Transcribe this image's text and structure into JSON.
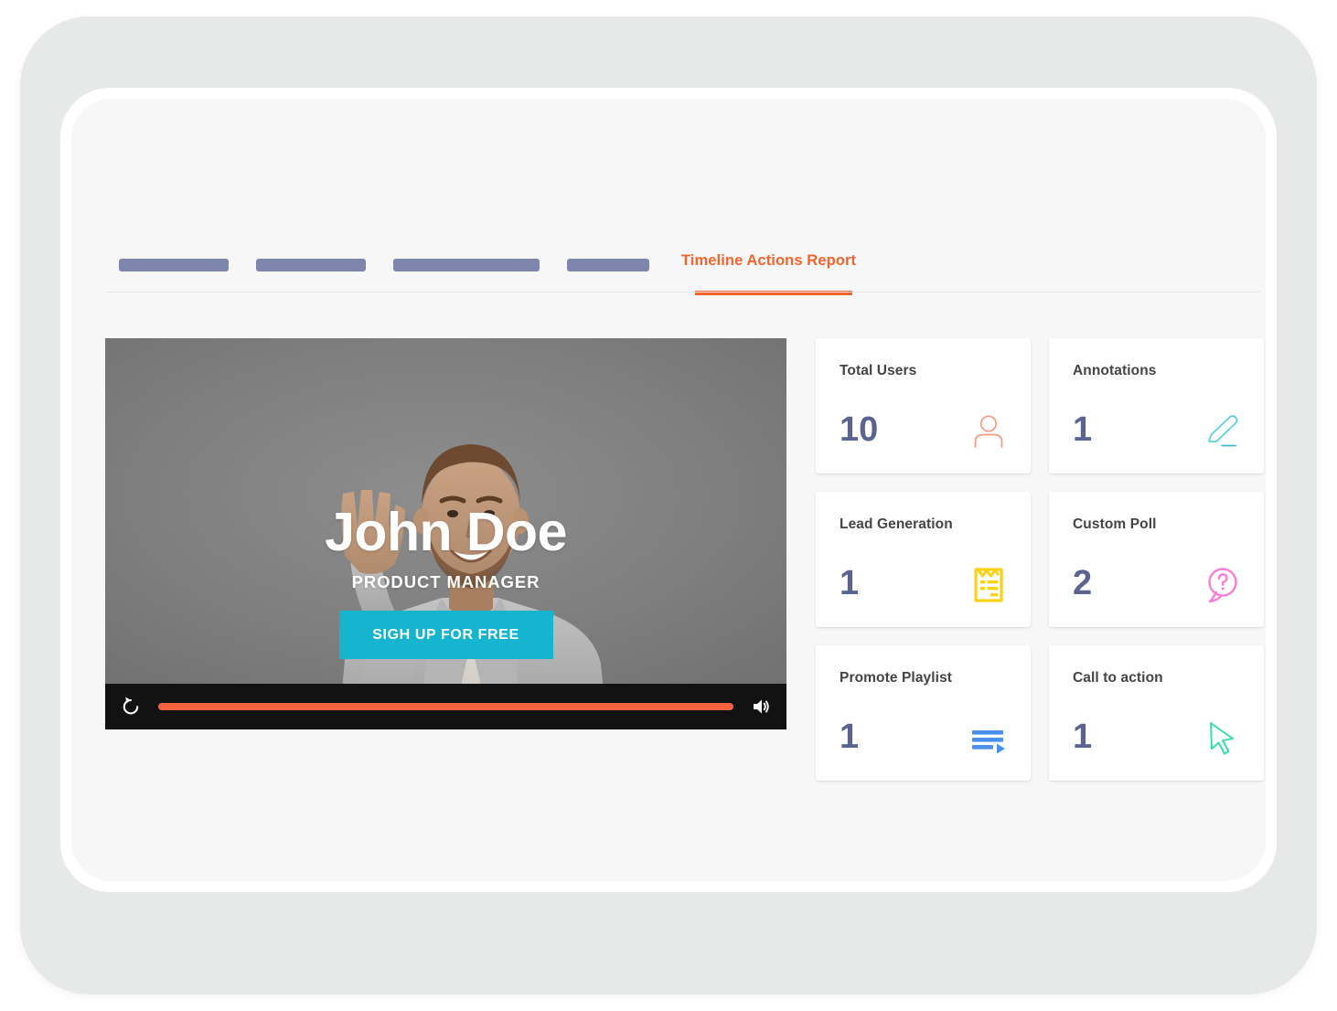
{
  "nav": {
    "placeholders": [
      {
        "name": "nav-placeholder-1"
      },
      {
        "name": "nav-placeholder-2"
      },
      {
        "name": "nav-placeholder-3"
      },
      {
        "name": "nav-placeholder-4"
      }
    ],
    "active_tab": "Timeline Actions Report",
    "accent_color": "#f4642c"
  },
  "video": {
    "name": "John Doe",
    "role": "PRODUCT MANAGER",
    "cta_label": "SIGH UP FOR FREE",
    "cta_color": "#16b5cf",
    "progress_percent": 100,
    "progress_color": "#f4623f",
    "replay_icon": "replay-icon",
    "volume_icon": "volume-icon"
  },
  "cards": [
    {
      "label": "Total Users",
      "value": "10",
      "icon": "user-icon",
      "icon_color": "#f79a7e"
    },
    {
      "label": "Annotations",
      "value": "1",
      "icon": "pencil-icon",
      "icon_color": "#5bd0e2"
    },
    {
      "label": "Lead Generation",
      "value": "1",
      "icon": "form-icon",
      "icon_color": "#fcd116"
    },
    {
      "label": "Custom Poll",
      "value": "2",
      "icon": "question-bubble-icon",
      "icon_color": "#f97fd4"
    },
    {
      "label": "Promote Playlist",
      "value": "1",
      "icon": "playlist-icon",
      "icon_color": "#4a90f0"
    },
    {
      "label": "Call to action",
      "value": "1",
      "icon": "cursor-icon",
      "icon_color": "#2fe0a0"
    }
  ],
  "theme": {
    "value_color": "#5b6490",
    "label_color": "#444444",
    "nav_placeholder_color": "#7e86ad"
  }
}
